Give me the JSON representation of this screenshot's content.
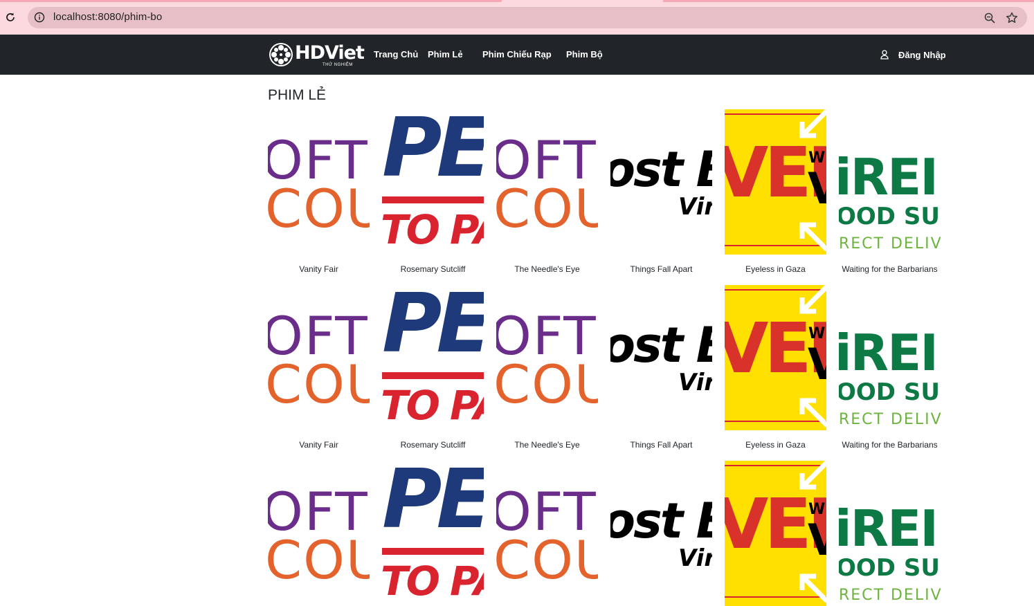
{
  "browser": {
    "url_host": "localhost",
    "url_rest": ":8080/phim-bo"
  },
  "navbar": {
    "logo_text": "HDViet",
    "logo_subtext": "THỬ NGHIỆM",
    "items": [
      {
        "label": "Trang Chủ"
      },
      {
        "label": "Phim Lẻ"
      },
      {
        "label": "Phim Chiếu Rạp"
      },
      {
        "label": "Phim Bộ"
      }
    ],
    "login_label": "Đăng Nhập"
  },
  "section_title": "PHIM LẺ",
  "movies": [
    {
      "title": "Vanity Fair",
      "poster": "soft"
    },
    {
      "title": "Rosemary Sutcliff",
      "poster": "peer"
    },
    {
      "title": "The Needle's Eye",
      "poster": "soft"
    },
    {
      "title": "Things Fall Apart",
      "poster": "ghost"
    },
    {
      "title": "Eyeless in Gaza",
      "poster": "web"
    },
    {
      "title": "Waiting for the Barbarians",
      "poster": "green"
    }
  ],
  "poster_text": {
    "soft": [
      "OFT",
      "COU"
    ],
    "peer": [
      "PEE",
      "TO PART"
    ],
    "ghost": [
      "ost B",
      "Vir"
    ],
    "web": [
      "VEB",
      "WE",
      "V"
    ],
    "green": [
      "iREI",
      "OOD SUP",
      "RECT DELIVE"
    ]
  },
  "colors": {
    "chrome_bg": "#fbd9de",
    "navbar_bg": "#212529",
    "purple": "#6a2e8a",
    "orange": "#e4622c",
    "navy": "#1f3a7a",
    "red": "#d9232f",
    "yellow": "#ffe000",
    "green": "#0d7a45"
  }
}
